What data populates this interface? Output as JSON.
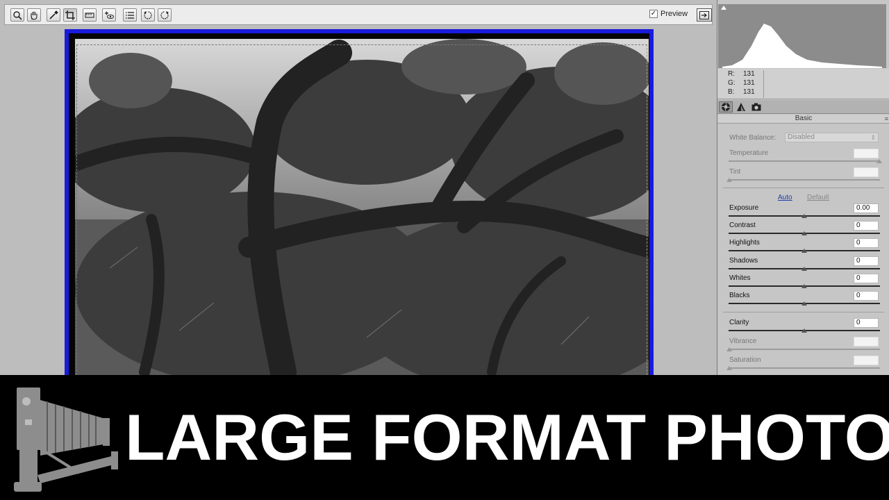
{
  "toolbar": {
    "tools": [
      {
        "name": "zoom-tool",
        "icon": "magnifier-icon"
      },
      {
        "name": "hand-tool",
        "icon": "hand-icon"
      },
      {
        "name": "eyedropper-tool",
        "icon": "eyedropper-icon"
      },
      {
        "name": "crop-tool",
        "icon": "crop-icon"
      },
      {
        "name": "straighten-tool",
        "icon": "straighten-icon"
      },
      {
        "name": "redeye-tool",
        "icon": "redeye-icon"
      },
      {
        "name": "preferences-tool",
        "icon": "list-icon"
      },
      {
        "name": "rotate-left-tool",
        "icon": "rotate-ccw-icon"
      },
      {
        "name": "rotate-right-tool",
        "icon": "rotate-cw-icon"
      }
    ],
    "preview_label": "Preview",
    "preview_checked": true
  },
  "rgb": {
    "r_label": "R:",
    "r": "131",
    "g_label": "G:",
    "g": "131",
    "b_label": "B:",
    "b": "131"
  },
  "panel": {
    "title": "Basic",
    "white_balance_label": "White Balance:",
    "white_balance_value": "Disabled",
    "temperature_label": "Temperature",
    "tint_label": "Tint",
    "auto_label": "Auto",
    "default_label": "Default",
    "sliders": [
      {
        "label": "Exposure",
        "value": "0.00"
      },
      {
        "label": "Contrast",
        "value": "0"
      },
      {
        "label": "Highlights",
        "value": "0"
      },
      {
        "label": "Shadows",
        "value": "0"
      },
      {
        "label": "Whites",
        "value": "0"
      },
      {
        "label": "Blacks",
        "value": "0"
      }
    ],
    "clarity_label": "Clarity",
    "clarity_value": "0",
    "vibrance_label": "Vibrance",
    "saturation_label": "Saturation"
  },
  "banner": {
    "title": "LARGE FORMAT PHOTO"
  },
  "colors": {
    "frame_blue": "#1a1add",
    "panel_bg": "#c6c6c6",
    "banner_bg": "#000000",
    "link_blue": "#1a3ea8"
  }
}
